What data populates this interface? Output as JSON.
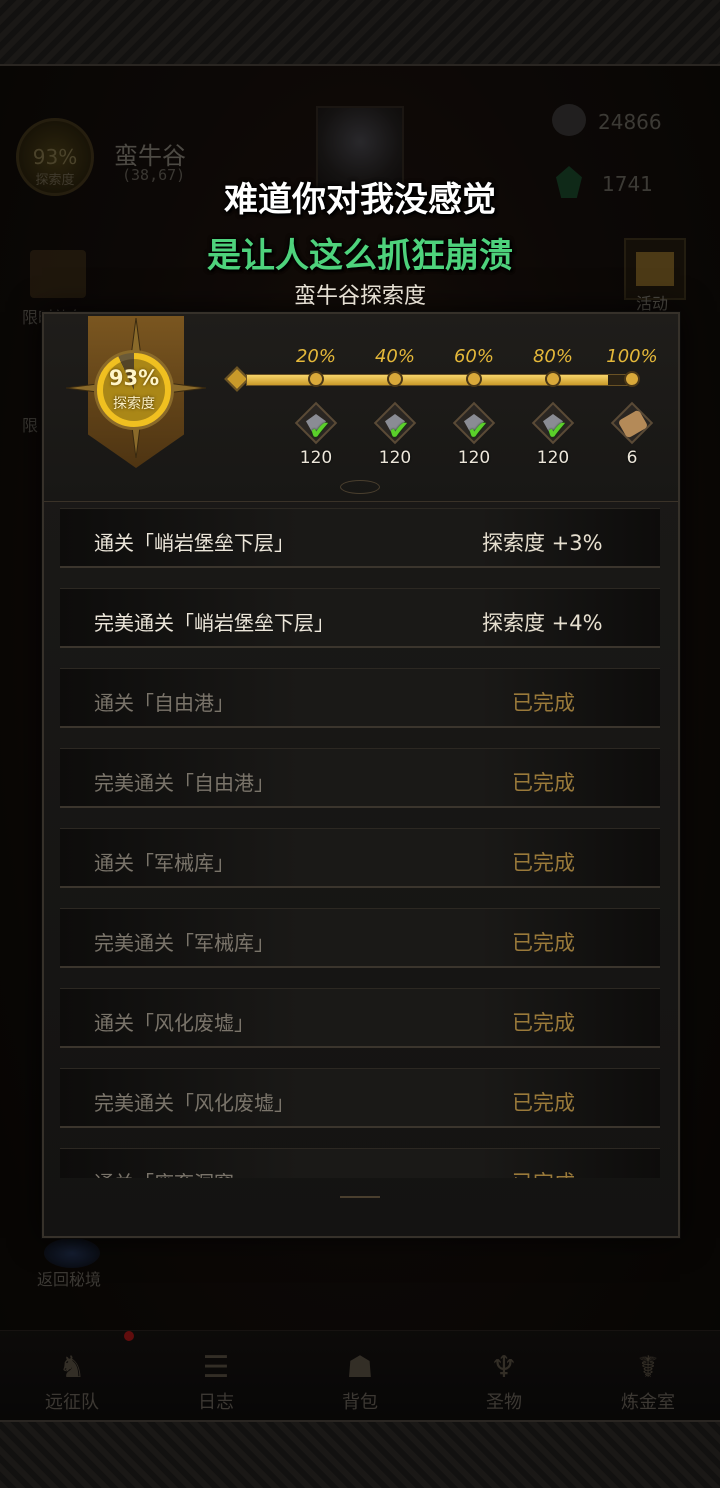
{
  "captions": {
    "line1": "难道你对我没感觉",
    "line2": "是让人这么抓狂崩溃"
  },
  "background": {
    "location": {
      "percent": "93%",
      "label": "探索度",
      "name": "蛮牛谷",
      "coords": "(38,67)"
    },
    "resources": {
      "stone": "24866",
      "gem": "1741"
    },
    "left_buttons": {
      "gift_label": "限时礼包",
      "second_label": "限"
    },
    "right_button": {
      "label": "活动"
    },
    "back_label": "返回秘境"
  },
  "modal": {
    "title": "蛮牛谷探索度",
    "badge": {
      "percent": "93%",
      "label": "探索度",
      "progress": 0.93
    },
    "milestones": [
      {
        "label": "20%",
        "count": "120",
        "icon": "arrowhead-icon",
        "claimed": true
      },
      {
        "label": "40%",
        "count": "120",
        "icon": "arrowhead-icon",
        "claimed": true
      },
      {
        "label": "60%",
        "count": "120",
        "icon": "arrowhead-icon",
        "claimed": true
      },
      {
        "label": "80%",
        "count": "120",
        "icon": "arrowhead-icon",
        "claimed": true
      },
      {
        "label": "100%",
        "count": "6",
        "icon": "scroll-icon",
        "claimed": false
      }
    ],
    "tasks": [
      {
        "name": "通关「峭岩堡垒下层」",
        "reward": "探索度 +3%",
        "done": false
      },
      {
        "name": "完美通关「峭岩堡垒下层」",
        "reward": "探索度 +4%",
        "done": false
      },
      {
        "name": "通关「自由港」",
        "reward": "已完成",
        "done": true
      },
      {
        "name": "完美通关「自由港」",
        "reward": "已完成",
        "done": true
      },
      {
        "name": "通关「军械库」",
        "reward": "已完成",
        "done": true
      },
      {
        "name": "完美通关「军械库」",
        "reward": "已完成",
        "done": true
      },
      {
        "name": "通关「风化废墟」",
        "reward": "已完成",
        "done": true
      },
      {
        "name": "完美通关「风化废墟」",
        "reward": "已完成",
        "done": true
      },
      {
        "name": "通关「废弃洞窟」",
        "reward": "已完成",
        "done": true
      }
    ]
  },
  "nav": [
    {
      "label": "远征队",
      "icon": "viking-helmet-icon",
      "glyph": "♞",
      "badge": true
    },
    {
      "label": "日志",
      "icon": "journal-icon",
      "glyph": "☰",
      "badge": false
    },
    {
      "label": "背包",
      "icon": "backpack-icon",
      "glyph": "☗",
      "badge": false
    },
    {
      "label": "圣物",
      "icon": "chalice-icon",
      "glyph": "♆",
      "badge": false
    },
    {
      "label": "炼金室",
      "icon": "alchemy-icon",
      "glyph": "☤",
      "badge": false
    }
  ],
  "colors": {
    "accent_gold": "#e4b83a",
    "caption_green": "#4ed27c",
    "check_green": "#5ad02a",
    "badge_red": "#b01818"
  }
}
